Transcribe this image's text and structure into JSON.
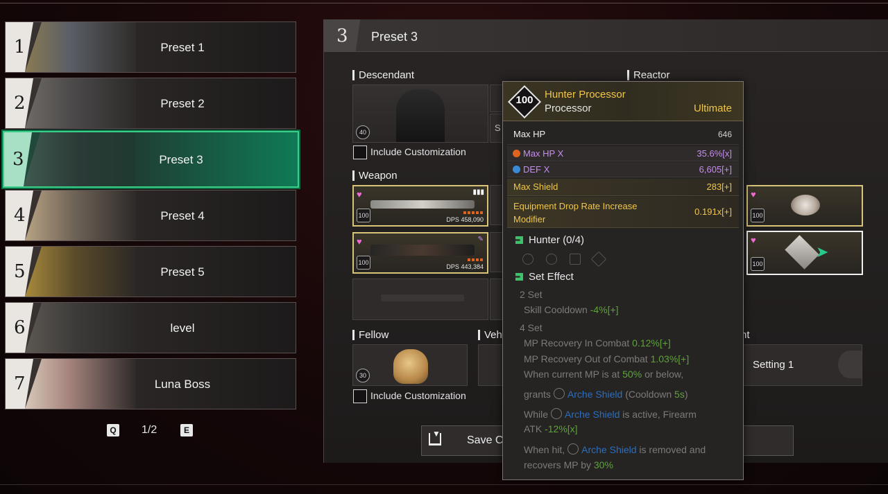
{
  "presets": [
    {
      "num": "1",
      "name": "Preset 1"
    },
    {
      "num": "2",
      "name": "Preset 2"
    },
    {
      "num": "3",
      "name": "Preset 3"
    },
    {
      "num": "4",
      "name": "Preset 4"
    },
    {
      "num": "5",
      "name": "Preset 5"
    },
    {
      "num": "6",
      "name": "level"
    },
    {
      "num": "7",
      "name": "Luna Boss"
    }
  ],
  "pagination": {
    "prev_key": "Q",
    "page": "1/2",
    "next_key": "E"
  },
  "panel": {
    "number": "3",
    "title": "Preset 3",
    "sections": {
      "descendant": "Descendant",
      "reactor": "Reactor",
      "weapon": "Weapon",
      "fellow": "Fellow",
      "vehicle": "Vehi",
      "setting_partial": "nt"
    },
    "descendant_level": "40",
    "include_customization": "Include Customization",
    "weapons": [
      {
        "level": "100",
        "dps_label": "DPS",
        "dps": "458,090"
      },
      {
        "level": "100",
        "dps_label": "DPS",
        "dps": "443,384"
      }
    ],
    "fellow_level": "30",
    "setting_label": "Setting 1",
    "partial_slot_letter": "S",
    "save_label": "Save C",
    "component_levels": [
      "100",
      "100"
    ]
  },
  "tooltip": {
    "level": "100",
    "name": "Hunter Processor",
    "type": "Processor",
    "tier": "Ultimate",
    "base_stat": {
      "label": "Max HP",
      "value": "646"
    },
    "substats": [
      {
        "label": "Max HP X",
        "value": "35.6%[x]",
        "color": "#c58df0"
      },
      {
        "label": "DEF X",
        "value": "6,605[+]",
        "color": "#c58df0"
      }
    ],
    "gold_stats": [
      {
        "label": "Max Shield",
        "value": "283[+]"
      },
      {
        "label": "Equipment Drop Rate Increase Modifier",
        "value": "0.191x[+]"
      }
    ],
    "set_name": "Hunter (0/4)",
    "set_effect_title": "Set Effect",
    "set2": {
      "title": "2 Set",
      "stat": "Skill Cooldown",
      "value": "-4%[+]"
    },
    "set4": {
      "title": "4 Set",
      "line1_stat": "MP Recovery In Combat",
      "line1_value": "0.12%[+]",
      "line2_stat": "MP Recovery Out of Combat",
      "line2_value": "1.03%[+]",
      "line3a": "When current MP is at",
      "line3_value": "50%",
      "line3b": "or below,",
      "line4a": "grants",
      "line4_skill": "Arche Shield",
      "line4b": "(Cooldown",
      "line4_value": "5s",
      "line4c": ")",
      "line5a": "While",
      "line5_skill": "Arche Shield",
      "line5b": "is active, Firearm",
      "line6a": "ATK",
      "line6_value": "-12%[x]",
      "line7a": "When hit,",
      "line7_skill": "Arche Shield",
      "line7b": "is removed and",
      "line8a": "recovers MP by",
      "line8_value": "30%"
    }
  },
  "colors": {
    "accent_green": "#3bd08a",
    "gold": "#d8c57a",
    "ultimate": "#f0c64a",
    "set_green": "#5fa33b",
    "skill_blue": "#2a6fbf"
  }
}
